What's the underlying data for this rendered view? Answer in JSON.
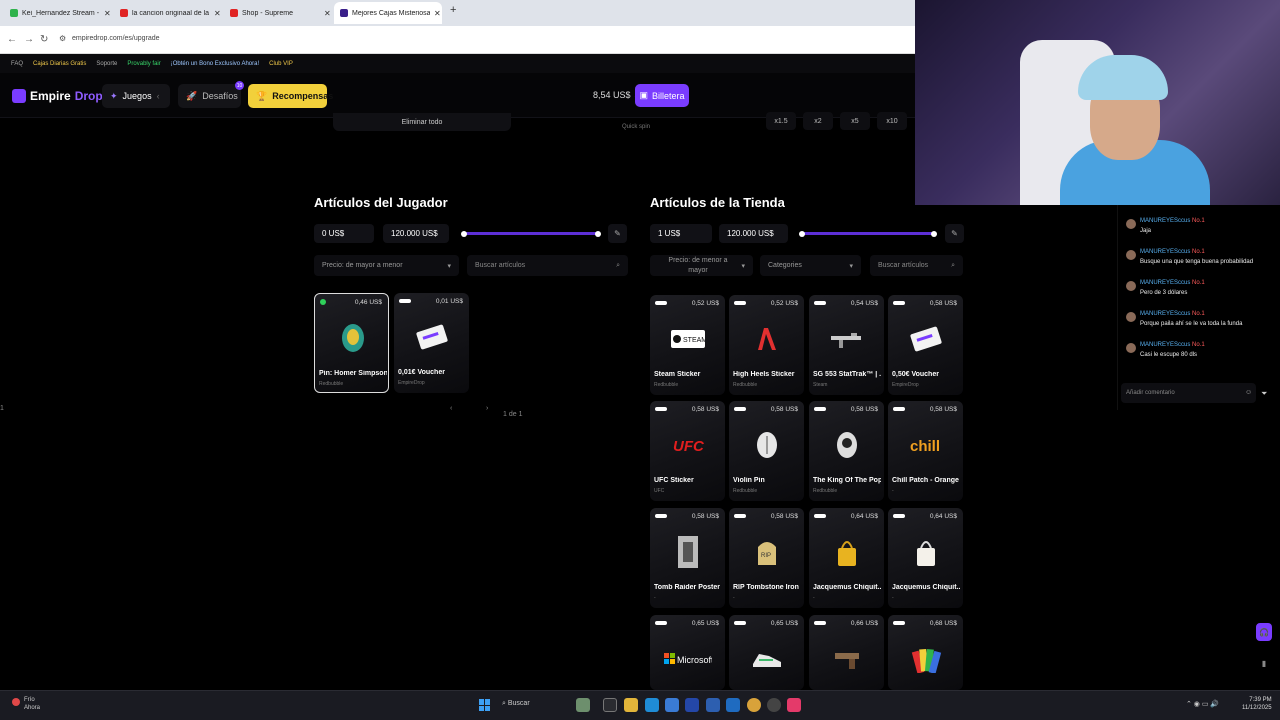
{
  "browser": {
    "tabs": [
      {
        "title": "Kei_Hernandez Stream - Watch",
        "color": "#2fb24c",
        "active": false
      },
      {
        "title": "la cancion originaal de la par",
        "color": "#e02424",
        "active": false
      },
      {
        "title": "Shop - Supreme",
        "color": "#e02424",
        "active": false
      },
      {
        "title": "Mejores Cajas Misteriosas | Emp",
        "color": "#3a1f8a",
        "active": true
      }
    ],
    "url": "empiredrop.com/es/upgrade"
  },
  "topstrip": {
    "items": [
      "FAQ",
      "Cajas Diarias Gratis",
      "Soporte",
      "Provably fair",
      "¡Obtén un Bono Exclusivo Ahora!",
      "Club VIP"
    ]
  },
  "nav": {
    "logo_a": "Empire",
    "logo_b": "Drop",
    "games": "Juegos",
    "challenges": "Desafíos",
    "challenges_badge": "10",
    "rewards": "Recompensas",
    "balance": "8,54 US$",
    "wallet": "Billetera"
  },
  "upper": {
    "remove_all": "Eliminar todo",
    "quick_spin": "Quick spin",
    "multipliers": [
      "x1.5",
      "x2",
      "x5",
      "x10"
    ]
  },
  "player": {
    "title": "Artículos del Jugador",
    "min": "0 US$",
    "max": "120.000 US$",
    "sort": "Precio: de mayor a menor",
    "search_placeholder": "Buscar artículos",
    "pager_page": "1",
    "pager_info": "1 de 1",
    "items": [
      {
        "price": "0,46 US$",
        "name": "Pin: Homer Simpson ...",
        "brand": "Redbubble",
        "selected": true
      },
      {
        "price": "0,01 US$",
        "name": "0,01€ Voucher",
        "brand": "EmpireDrop",
        "selected": false
      }
    ]
  },
  "shop": {
    "title": "Artículos de la Tienda",
    "min": "1 US$",
    "max": "120.000 US$",
    "sort": "Precio: de menor a mayor",
    "categories": "Categories",
    "search_placeholder": "Buscar artículos",
    "items": [
      {
        "price": "0,52 US$",
        "name": "Steam Sticker",
        "brand": "Redbubble",
        "icon": "steam-logo-icon"
      },
      {
        "price": "0,52 US$",
        "name": "High Heels Sticker",
        "brand": "Redbubble",
        "icon": "high-heels-icon"
      },
      {
        "price": "0,54 US$",
        "name": "SG 553 StatTrak™ | ...",
        "brand": "Steam",
        "icon": "rifle-icon"
      },
      {
        "price": "0,58 US$",
        "name": "0,50€ Voucher",
        "brand": "EmpireDrop",
        "icon": "voucher-icon"
      },
      {
        "price": "0,58 US$",
        "name": "UFC Sticker",
        "brand": "UFC",
        "icon": "ufc-logo-icon"
      },
      {
        "price": "0,58 US$",
        "name": "Violin Pin",
        "brand": "Redbubble",
        "icon": "violin-pin-icon"
      },
      {
        "price": "0,58 US$",
        "name": "The King Of The Pop ...",
        "brand": "Redbubble",
        "icon": "pop-pin-icon"
      },
      {
        "price": "0,58 US$",
        "name": "Chill Patch - Orange",
        "brand": "-",
        "icon": "chill-patch-icon"
      },
      {
        "price": "0,58 US$",
        "name": "Tomb Raider Poster",
        "brand": "-",
        "icon": "poster-icon"
      },
      {
        "price": "0,58 US$",
        "name": "RIP Tombstone Iron ...",
        "brand": "-",
        "icon": "tombstone-icon"
      },
      {
        "price": "0,64 US$",
        "name": "Jacquemus Chiquit...",
        "brand": "-",
        "icon": "yellow-bag-icon"
      },
      {
        "price": "0,64 US$",
        "name": "Jacquemus Chiquit...",
        "brand": "-",
        "icon": "white-bag-icon"
      },
      {
        "price": "0,65 US$",
        "name": "",
        "brand": "",
        "icon": "microsoft-logo-icon"
      },
      {
        "price": "0,65 US$",
        "name": "",
        "brand": "",
        "icon": "sneaker-icon"
      },
      {
        "price": "0,66 US$",
        "name": "",
        "brand": "",
        "icon": "pistol-icon"
      },
      {
        "price": "0,68 US$",
        "name": "",
        "brand": "",
        "icon": "color-cards-icon"
      }
    ]
  },
  "chat": {
    "messages": [
      {
        "user": "MANUREYESccus",
        "rank": "No.1",
        "text": "Jaja"
      },
      {
        "user": "MANUREYESccus",
        "rank": "No.1",
        "text": "Busque una que tenga buena probabilidad"
      },
      {
        "user": "MANUREYESccus",
        "rank": "No.1",
        "text": "Pero de 3 dólares"
      },
      {
        "user": "MANUREYESccus",
        "rank": "No.1",
        "text": "Porque paila ahí se le va toda la funda"
      },
      {
        "user": "MANUREYESccus",
        "rank": "No.1",
        "text": "Casi le escupe 80 dls"
      }
    ],
    "comment_placeholder": "Añadir comentario"
  },
  "taskbar": {
    "weather_temp": "Frío",
    "weather_sub": "Ahora",
    "search": "Buscar",
    "time": "7:39 PM",
    "date": "11/12/2025"
  }
}
